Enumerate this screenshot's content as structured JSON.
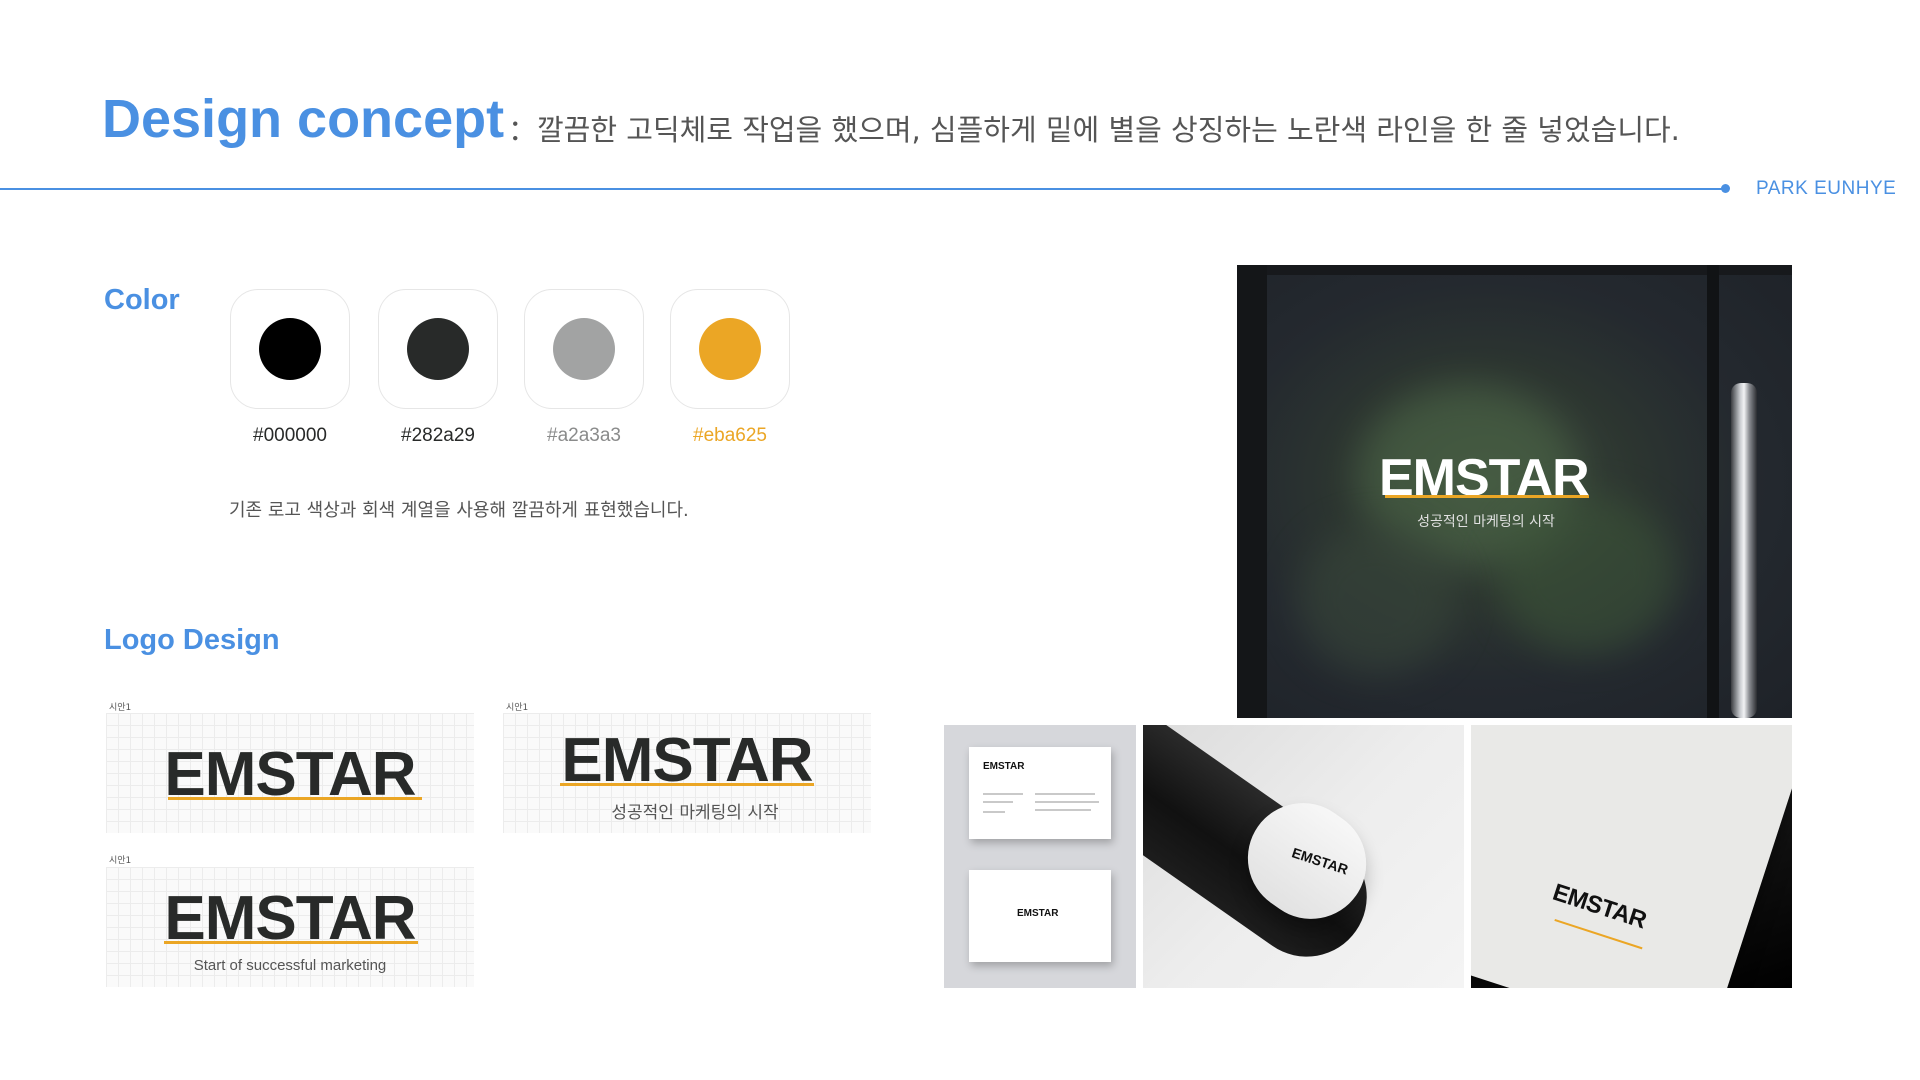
{
  "header": {
    "title": "Design concept",
    "subtitle": "：깔끔한 고딕체로 작업을 했으며, 심플하게 밑에 별을 상징하는 노란색 라인을 한 줄 넣었습니다.",
    "author": "PARK EUNHYE",
    "accent_color": "#4a90e2"
  },
  "color_section": {
    "heading": "Color",
    "swatches": [
      {
        "hex": "#000000",
        "label": "#000000",
        "label_color": "#282a29"
      },
      {
        "hex": "#282a29",
        "label": "#282a29",
        "label_color": "#282a29"
      },
      {
        "hex": "#a2a3a3",
        "label": "#a2a3a3",
        "label_color": "#8a8b8b"
      },
      {
        "hex": "#eba625",
        "label": "#eba625",
        "label_color": "#eba625"
      }
    ],
    "note": "기존 로고 색상과 회색 계열을 사용해 깔끔하게 표현했습니다."
  },
  "logo_section": {
    "heading": "Logo Design",
    "variants": [
      {
        "label": "시안1",
        "wordmark": "EMSTAR",
        "tagline": ""
      },
      {
        "label": "시안1",
        "wordmark": "EMSTAR",
        "tagline": "성공적인 마케팅의 시작"
      },
      {
        "label": "시안1",
        "wordmark": "EMSTAR",
        "tagline": "Start of successful marketing"
      }
    ]
  },
  "mockups": {
    "window": {
      "wordmark": "EMSTAR",
      "tagline": "성공적인 마케팅의 시작"
    },
    "business_cards": {
      "wordmark_front": "EMSTAR",
      "wordmark_back": "EMSTAR"
    },
    "tube": {
      "wordmark": "EMSTAR"
    },
    "paper": {
      "wordmark": "EMSTAR"
    }
  }
}
